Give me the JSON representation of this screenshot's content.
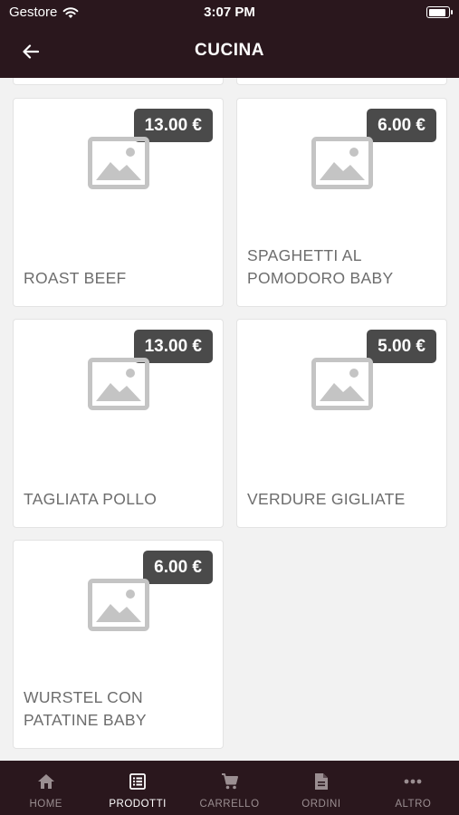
{
  "status_bar": {
    "carrier": "Gestore",
    "time": "3:07 PM",
    "battery_level": 0.9
  },
  "header": {
    "title": "CUCINA"
  },
  "products": [
    {
      "name": "ROAST BEEF",
      "price": "13.00 €"
    },
    {
      "name": "SPAGHETTI AL POMODORO BABY",
      "price": "6.00 €"
    },
    {
      "name": "TAGLIATA POLLO",
      "price": "13.00 €"
    },
    {
      "name": "VERDURE GIGLIATE",
      "price": "5.00 €"
    },
    {
      "name": "WURSTEL CON PATATINE BABY",
      "price": "6.00 €"
    }
  ],
  "tabs": [
    {
      "label": "HOME",
      "icon": "home-icon"
    },
    {
      "label": "PRODOTTI",
      "icon": "list-icon",
      "active": true
    },
    {
      "label": "CARRELLO",
      "icon": "cart-icon"
    },
    {
      "label": "ORDINI",
      "icon": "document-icon"
    },
    {
      "label": "ALTRO",
      "icon": "more-icon"
    }
  ],
  "colors": {
    "bar_background": "#2a171d",
    "badge": "#4a4a4a",
    "page_background": "#f2f2f2",
    "tab_inactive": "#9a8e91"
  }
}
